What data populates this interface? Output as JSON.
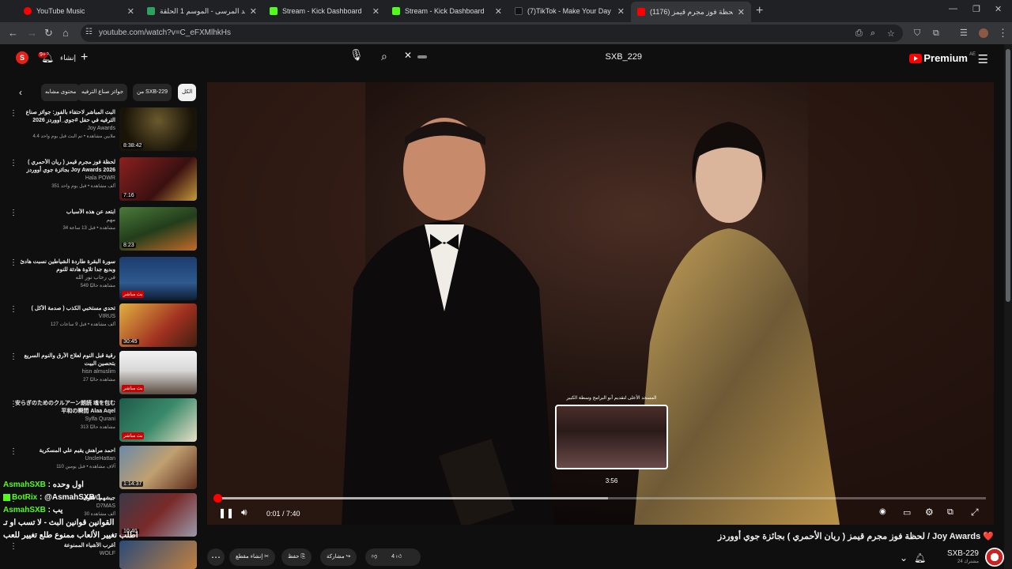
{
  "browser": {
    "tabs": [
      {
        "title": "YouTube Music",
        "color": "#ff0000"
      },
      {
        "title": "شاهد المرسى - الموسم 1 الحلقة",
        "color": "#2ca25f"
      },
      {
        "title": "Stream - Kick Dashboard",
        "color": "#53fc18"
      },
      {
        "title": "Stream - Kick Dashboard",
        "color": "#53fc18"
      },
      {
        "title": "(7)TikTok - Make Your Day",
        "color": "#111111"
      },
      {
        "title": "(1176) لحظة فوز مجرم قيمز",
        "color": "#ff0000"
      }
    ],
    "url": "youtube.com/watch?v=C_eFXMlhkHs"
  },
  "yt_header": {
    "brand": "Premium",
    "brand_super": "AE",
    "search_query": "SXB_229",
    "create_label": "إنشاء",
    "notification_count": "9+",
    "avatar_letter": "S"
  },
  "chips": [
    {
      "label": "الكل"
    },
    {
      "label": "من SXB-229"
    },
    {
      "label": "جوائز صناع الترفيه"
    },
    {
      "label": "محتوى مشابه"
    }
  ],
  "related": [
    {
      "title": "البث المباشر لاحتفاء بالفوز: جوائز صناع الترفيه في حفل #جوي_أووردز 2026",
      "channel": "Joy Awards",
      "stats": "4.4 ملايين مشاهدة • تم البث قبل يوم واحد",
      "duration": "8:38:42",
      "badge": ""
    },
    {
      "title": "لحظة فوز مجرم قيمز ( ريان الأحمري ) بجائزة جوي أووردز Joy Awards 2026",
      "channel": "Hala POWR",
      "stats": "351 ألف مشاهدة • قبل يوم واحد",
      "duration": "7:16",
      "badge": ""
    },
    {
      "title": "ابتعد عن هذه الأسباب",
      "channel": "مهم",
      "stats": "34 مشاهدة • قبل 13 ساعة",
      "duration": "8:23",
      "badge": ""
    },
    {
      "title": "سورة البقرة طاردة الشياطين نسبت هادئ وبديع جدا تلاوة هادئة للنوم",
      "channel": "في رحاب نور الله",
      "stats": "549 مشاهدة حاليًا",
      "duration": "",
      "badge": "بث مباشر"
    },
    {
      "title": "تحدي مستخبي الكذب ( صدمة الأكل )",
      "channel": "VIRUS",
      "stats": "127 ألف مشاهدة • قبل 9 ساعات",
      "duration": "30:45",
      "badge": ""
    },
    {
      "title": "رقية قبل النوم لعلاج الأرق والنوم السريع بتحصين البيت",
      "channel": "hisn almuslim",
      "stats": "27 مشاهدة حاليًا",
      "duration": "",
      "badge": "بث مباشر"
    },
    {
      "title": "安らぎのためのクルアーン朗読 魂を包む平和の瞬間 Alaa Aqel",
      "channel": "Sylfa Qurani",
      "stats": "313 مشاهدة حاليًا",
      "duration": "",
      "badge": "بث مباشر"
    },
    {
      "title": "احمد مراهش يقيم علي المسكرية",
      "channel": "UncleHattan",
      "stats": "110 آلاف مشاهدة • قبل يومين",
      "duration": "1:14:37",
      "badge": ""
    },
    {
      "title": "جيشهم الأقوى",
      "channel": "D7MAS",
      "stats": "30 ألف مشاهدة",
      "duration": "10:40",
      "badge": ""
    },
    {
      "title": "أغرب الأشياء الممنوعة",
      "channel": "WOLF",
      "stats": "",
      "duration": "",
      "badge": ""
    }
  ],
  "player": {
    "current_time": "0:01",
    "total_time": "7:40",
    "preview_time": "3:56",
    "preview_title": "المسجد الأعلى لتقديم أبو البرامج وسطة الكبير",
    "played_fraction": 0.003,
    "hover_fraction": 0.51
  },
  "video": {
    "title": "لحظة فوز مجرم قيمز ( ريان الأحمري ) بجائزة جوي أووردز / Joy Awards ❤️",
    "channel": "SXB-229",
    "subs": "24 مشترك",
    "like_count": "4",
    "share_label": "مشاركة",
    "save_label": "حفظ",
    "clip_label": "إنشاء مقطع"
  },
  "chat": [
    {
      "user": "AsmahSXB",
      "msg": "اول وحده"
    },
    {
      "user": "BotRix",
      "msg": "@AsmahSXB 1"
    },
    {
      "user": "AsmahSXB",
      "msg": "يب"
    },
    {
      "user": "",
      "msg": "القوانين قوانين البث - لا تسب او تـ"
    },
    {
      "user": "",
      "msg": "اطلب تغيير الألعاب ممنوع طلع تغيير للعب"
    }
  ]
}
